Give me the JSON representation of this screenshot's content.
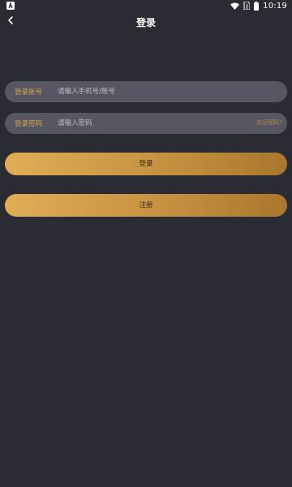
{
  "status_bar": {
    "time": "10:19",
    "left_icon": "a-notification-icon",
    "icons": [
      "wifi-icon",
      "sim-icon",
      "battery-icon"
    ]
  },
  "header": {
    "title": "登录",
    "back_icon": "back-arrow-icon"
  },
  "form": {
    "account": {
      "label": "登录账号",
      "placeholder": "请输入手机号/账号"
    },
    "password": {
      "label": "登录密码",
      "placeholder": "请输入密码",
      "forgot": "忘记密码?"
    }
  },
  "buttons": {
    "login": "登录",
    "register": "注册"
  },
  "colors": {
    "background": "#2b2b34",
    "field_bg": "#575763",
    "accent": "#d7a24a",
    "button_gradient_start": "#e0ad57",
    "button_gradient_end": "#a8772d"
  }
}
